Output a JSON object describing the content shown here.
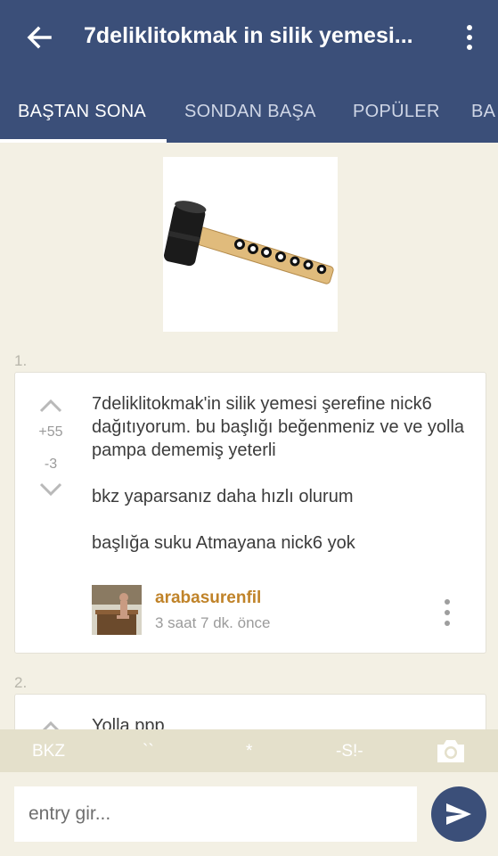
{
  "header": {
    "title": "7deliklitokmak in silik yemesi..."
  },
  "tabs": [
    {
      "label": "BAŞTAN SONA"
    },
    {
      "label": "SONDAN BAŞA"
    },
    {
      "label": "POPÜLER"
    },
    {
      "label": "BA"
    }
  ],
  "entries": [
    {
      "number": "1.",
      "upvotes": "+55",
      "downvotes": "-3",
      "paragraphs": [
        "7deliklitokmak'in silik yemesi şerefine nick6 dağıtıyorum. bu başlığı beğenmeniz ve ve yolla pampa dememiş yeterli",
        "bkz yaparsanız daha hızlı olurum",
        "başlığa suku Atmayana nick6 yok"
      ],
      "author": "arabasurenfil",
      "time": "3 saat 7 dk. önce"
    },
    {
      "number": "2.",
      "text": "Yolla ppp"
    }
  ],
  "toolbar": {
    "bkz": "BKZ",
    "backtick": "``",
    "star": "*",
    "spoiler": "-S!-"
  },
  "composer": {
    "placeholder": "entry gir..."
  },
  "colors": {
    "primary": "#3b4f79",
    "background": "#f3f0e4",
    "author": "#c08329",
    "toolbar": "#e4e0cb"
  }
}
